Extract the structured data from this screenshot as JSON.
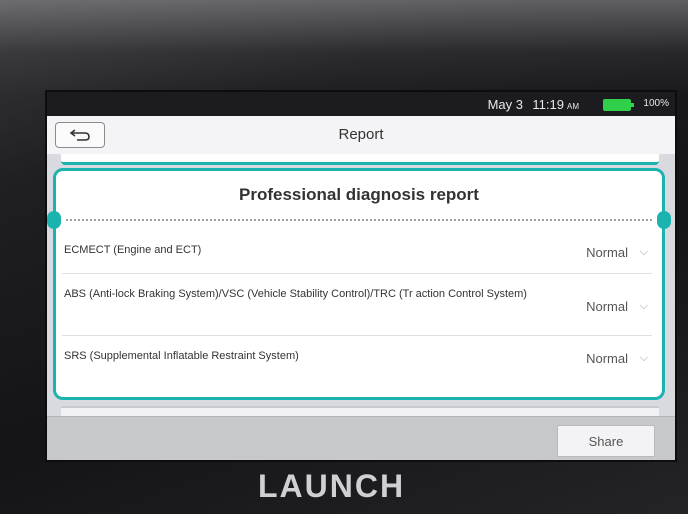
{
  "status_bar": {
    "date": "May 3",
    "time": "11:19",
    "ampm": "AM",
    "battery_pct": "100%",
    "battery_level": 1.0
  },
  "header": {
    "back_icon": "back-arrow-icon",
    "title": "Report"
  },
  "report": {
    "title": "Professional diagnosis report",
    "rows": [
      {
        "name": "ECMECT (Engine and ECT)",
        "status": "Normal"
      },
      {
        "name": "ABS (Anti-lock Braking System)/VSC (Vehicle Stability Control)/TRC (Tr action Control System)",
        "status": "Normal"
      },
      {
        "name": "SRS (Supplemental Inflatable Restraint System)",
        "status": "Normal"
      }
    ]
  },
  "footer": {
    "share_label": "Share"
  },
  "device": {
    "brand": "LAUNCH"
  },
  "colors": {
    "accent": "#1bb3b0",
    "battery": "#30d04a"
  }
}
